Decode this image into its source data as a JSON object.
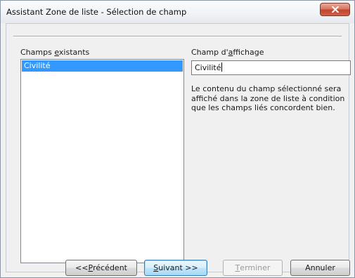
{
  "window": {
    "title": "Assistant Zone de liste - Sélection de champ"
  },
  "left_panel": {
    "label_pre": "Champs ",
    "label_mnemonic": "e",
    "label_post": "xistants",
    "items": [
      {
        "label": "Civilité",
        "selected": true
      }
    ]
  },
  "right_panel": {
    "label_pre": "Champ d'",
    "label_mnemonic": "a",
    "label_post": "ffichage",
    "field_value": "Civilité",
    "description": "Le contenu du champ sélectionné sera affiché dans la zone de liste à condition que les champs liés concordent bien."
  },
  "buttons": {
    "previous": {
      "pre": "<< ",
      "mnemonic": "P",
      "post": "récédent"
    },
    "next": {
      "pre": "",
      "mnemonic": "S",
      "post": "uivant >>"
    },
    "finish": {
      "pre": "",
      "mnemonic": "T",
      "post": "erminer",
      "disabled": true
    },
    "cancel": {
      "label": "Annuler"
    }
  },
  "colors": {
    "selection": "#3399ff",
    "close_button": "#c2432a",
    "default_button": "#a7d9f5"
  }
}
